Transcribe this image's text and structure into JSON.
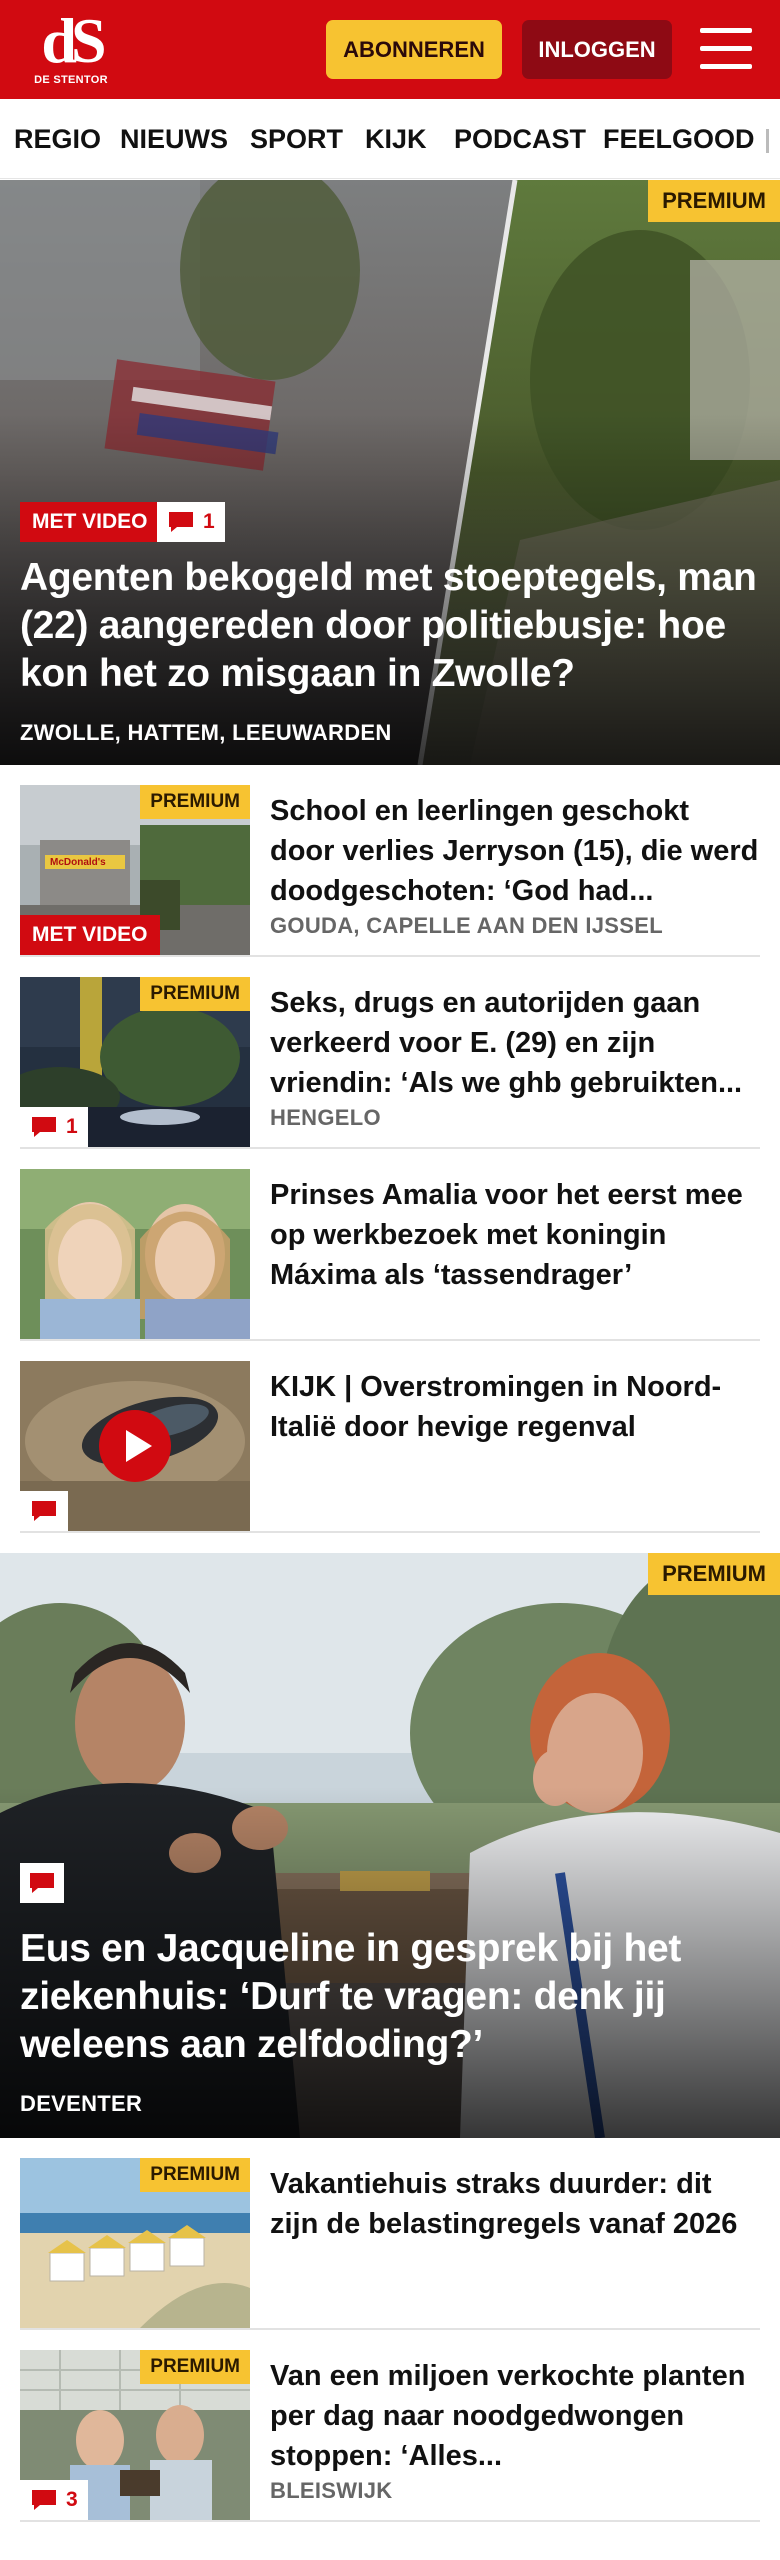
{
  "header": {
    "logo_mark": "dS",
    "logo_sub": "DE STENTOR",
    "subscribe_label": "ABONNEREN",
    "login_label": "INLOGGEN"
  },
  "nav": {
    "items": [
      {
        "label": "REGIO"
      },
      {
        "label": "NIEUWS"
      },
      {
        "label": "SPORT"
      },
      {
        "label": "KIJK"
      },
      {
        "label": "PODCAST"
      },
      {
        "label": "FEELGOOD"
      }
    ]
  },
  "hero1": {
    "premium": "PREMIUM",
    "video_badge": "MET VIDEO",
    "comments": "1",
    "title": "Agenten bekogeld met stoeptegels, man (22) aangereden door politiebus­je: hoe kon het zo misgaan in Zwolle?",
    "location": "ZWOLLE, HATTEM, LEEUWARDEN"
  },
  "articles": [
    {
      "premium": "PREMIUM",
      "video_badge": "MET VIDEO",
      "thumb_sign": "McDonald's",
      "title": "School en leerlingen geschokt door verlies Jerryson (15), die werd doodgeschoten: ‘God had...",
      "location": "GOUDA, CAPELLE AAN DEN IJSSEL"
    },
    {
      "premium": "PREMIUM",
      "comments": "1",
      "title": "Seks, drugs en autorijden gaan verkeerd voor E. (29) en zijn vriendin: ‘Als we ghb gebruikten...",
      "location": "HENGELO"
    },
    {
      "title": "Prinses Amalia voor het eerst mee op werkbezoek met koningin Máxima als ‘tassendrager’"
    },
    {
      "title": "KIJK | Overstromingen in Noord-Italië door hevige regenval"
    }
  ],
  "hero2": {
    "premium": "PREMIUM",
    "title": "Eus en Jacqueline in gesprek bij het ziekenhuis: ‘Durf te vragen: denk jij weleens aan zelfdoding?’",
    "location": "DEVENTER"
  },
  "articles2": [
    {
      "premium": "PREMIUM",
      "title": "Vakantiehuis straks duurder: dit zijn de belastingregels vanaf 2026"
    },
    {
      "premium": "PREMIUM",
      "comments": "3",
      "title": "Van een miljoen verkochte planten per dag naar noodgedwongen stoppen: ‘Alles...",
      "location": "BLEISWIJK"
    }
  ],
  "colors": {
    "brand_red": "#d10a11",
    "premium_yellow": "#f7c331",
    "login_dark_red": "#8e0a14"
  },
  "icons": [
    "menu-icon",
    "comment-icon",
    "play-icon"
  ]
}
